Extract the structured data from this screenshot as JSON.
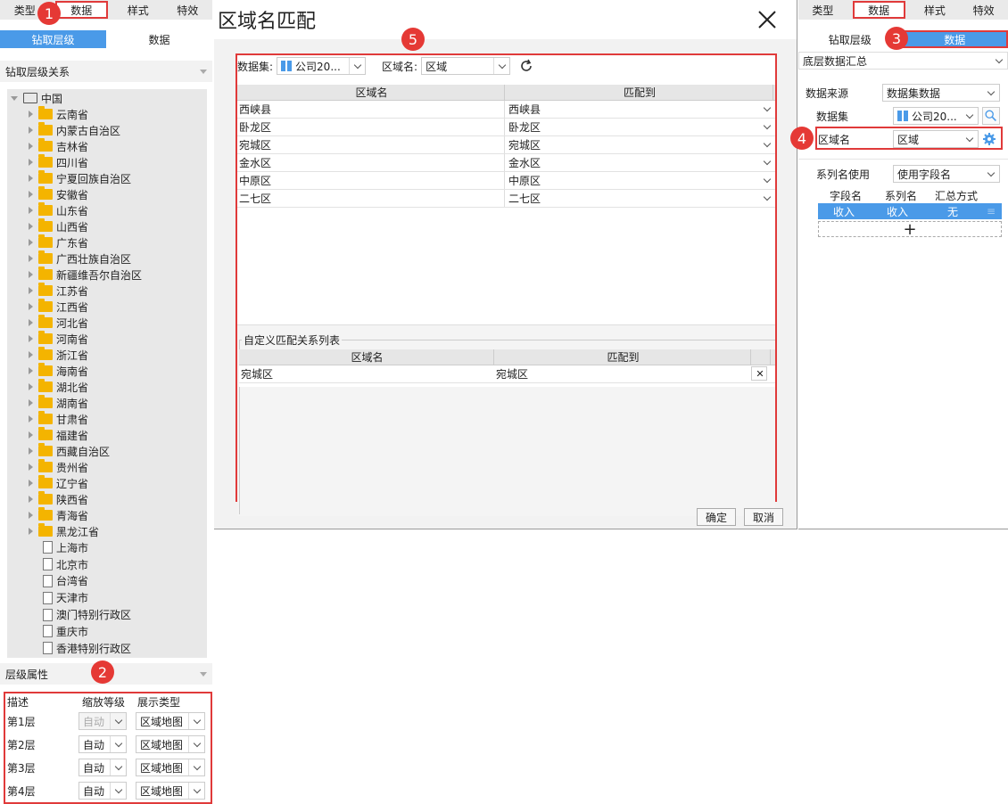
{
  "left": {
    "tabs": [
      "类型",
      "数据",
      "样式",
      "特效"
    ],
    "subtabs": [
      "钻取层级",
      "数据"
    ],
    "drill_section": "钻取层级关系",
    "root": "中国",
    "provinces": [
      "云南省",
      "内蒙古自治区",
      "吉林省",
      "四川省",
      "宁夏回族自治区",
      "安徽省",
      "山东省",
      "山西省",
      "广东省",
      "广西壮族自治区",
      "新疆维吾尔自治区",
      "江苏省",
      "江西省",
      "河北省",
      "河南省",
      "浙江省",
      "海南省",
      "湖北省",
      "湖南省",
      "甘肃省",
      "福建省",
      "西藏自治区",
      "贵州省",
      "辽宁省",
      "陕西省",
      "青海省",
      "黑龙江省"
    ],
    "cities": [
      "上海市",
      "北京市",
      "台湾省",
      "天津市",
      "澳门特别行政区",
      "重庆市",
      "香港特别行政区"
    ],
    "level_section": "层级属性",
    "level_headers": [
      "描述",
      "缩放等级",
      "展示类型"
    ],
    "levels": [
      {
        "name": "第1层",
        "zoom": "自动",
        "type": "区域地图"
      },
      {
        "name": "第2层",
        "zoom": "自动",
        "type": "区域地图"
      },
      {
        "name": "第3层",
        "zoom": "自动",
        "type": "区域地图"
      },
      {
        "name": "第4层",
        "zoom": "自动",
        "type": "区域地图"
      }
    ]
  },
  "dialog": {
    "title": "区域名匹配",
    "dataset_label": "数据集:",
    "dataset_value": "公司20...",
    "region_label": "区域名:",
    "region_value": "区域",
    "headers": [
      "区域名",
      "匹配到"
    ],
    "rows": [
      [
        "西峡县",
        "西峡县"
      ],
      [
        "卧龙区",
        "卧龙区"
      ],
      [
        "宛城区",
        "宛城区"
      ],
      [
        "金水区",
        "金水区"
      ],
      [
        "中原区",
        "中原区"
      ],
      [
        "二七区",
        "二七区"
      ]
    ],
    "custom_title": "自定义匹配关系列表",
    "custom_headers": [
      "区域名",
      "匹配到"
    ],
    "custom_rows": [
      [
        "宛城区",
        "宛城区"
      ]
    ],
    "ok": "确定",
    "cancel": "取消"
  },
  "right": {
    "tabs": [
      "类型",
      "数据",
      "样式",
      "特效"
    ],
    "subtabs": [
      "钻取层级",
      "数据"
    ],
    "summary": "底层数据汇总",
    "source_label": "数据来源",
    "source_value": "数据集数据",
    "dataset_label": "数据集",
    "dataset_value": "公司20...",
    "region_label": "区域名",
    "region_value": "区域",
    "series_label": "系列名使用",
    "series_value": "使用字段名",
    "table_headers": [
      "字段名",
      "系列名",
      "汇总方式"
    ],
    "table_row": [
      "收入",
      "收入",
      "无"
    ],
    "add": "+"
  },
  "badges": [
    "1",
    "2",
    "3",
    "4",
    "5"
  ]
}
